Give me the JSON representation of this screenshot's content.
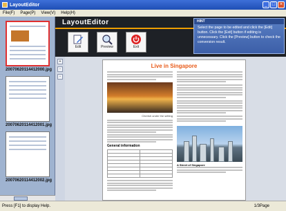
{
  "window": {
    "title": "LayoutEditor",
    "controls": [
      "_",
      "□",
      "×"
    ]
  },
  "menu": [
    "File(F)",
    "Page(P)",
    "View(V)",
    "Help(H)"
  ],
  "thumbnails": [
    {
      "caption": "20070620114412000.jpg",
      "selected": true
    },
    {
      "caption": "20070620114412001.jpg",
      "selected": false
    },
    {
      "caption": "20070620114412002.jpg",
      "selected": false
    }
  ],
  "header": {
    "app_name": "LayoutEditor",
    "tools": [
      {
        "label": "Edit",
        "icon": "edit-icon"
      },
      {
        "label": "Preview",
        "icon": "preview-icon"
      },
      {
        "label": "Exit",
        "icon": "power-icon"
      }
    ],
    "hint": {
      "heading": "HINT",
      "text": "Select the page to be edited and click the [Edit] button. Click the [Exit] button if editing is unnecessary. Click the [Preview] button to check the conversion result."
    }
  },
  "document": {
    "title": "Live in Singapore",
    "image_caption": "Cherish under the setting",
    "section": "General information",
    "city_caption": "A Street of Singapore"
  },
  "status": {
    "left": "Press [F1] to display Help.",
    "right": "1/3Page"
  },
  "colors": {
    "accent": "#f0a000",
    "title_bar": "#1f4fb5",
    "doc_title": "#e85a18"
  }
}
